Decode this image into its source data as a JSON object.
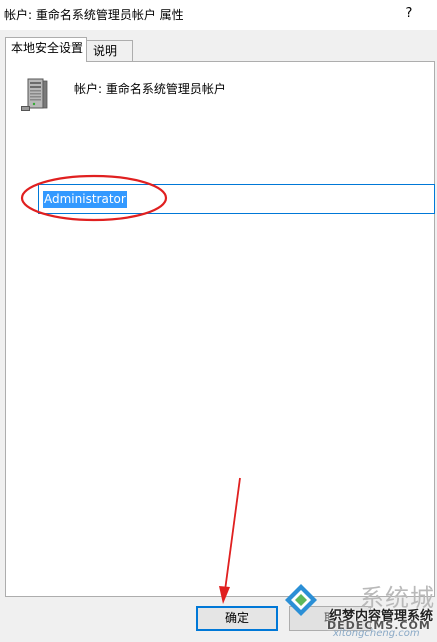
{
  "window": {
    "title": "帐户: 重命名系统管理员帐户 属性",
    "help_glyph": "?"
  },
  "tabs": [
    {
      "label": "本地安全设置",
      "active": true
    },
    {
      "label": "说明",
      "active": false
    }
  ],
  "policy": {
    "icon": "server-icon",
    "label": "帐户: 重命名系统管理员帐户"
  },
  "account_name": {
    "value": "Administrator",
    "selected": true
  },
  "buttons": {
    "ok_label": "确定",
    "cancel_label": "取"
  },
  "annotations": {
    "highlight_color": "#e02020",
    "highlight": "ellipse around account name value",
    "arrow": "arrow pointing to OK button"
  },
  "watermark": {
    "big_text": "系统城",
    "line1": "织梦内容管理系统",
    "line2": "DEDECMS.COM",
    "line3": "xitongcheng.com"
  },
  "colors": {
    "accent": "#0078d7",
    "selection": "#3399ff",
    "window_bg": "#f0f0f0",
    "annotation_red": "#e02020"
  }
}
